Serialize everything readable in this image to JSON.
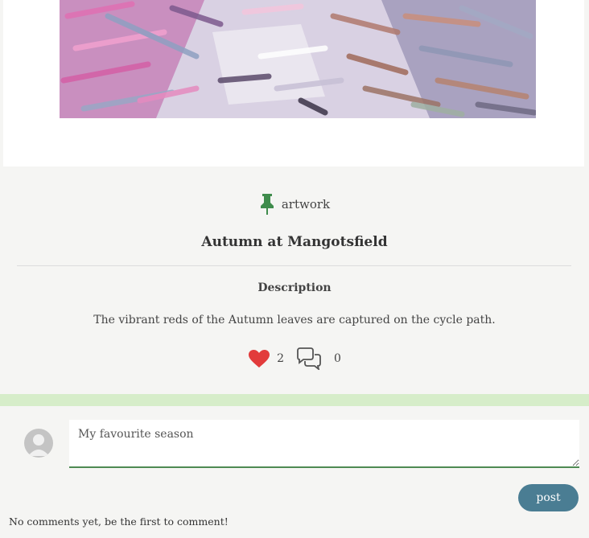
{
  "post": {
    "category": "artwork",
    "title": "Autumn at Mangotsfield",
    "description_heading": "Description",
    "description": "The vibrant reds of the Autumn leaves are captured on the cycle path.",
    "likes": "2",
    "comments": "0"
  },
  "comment_form": {
    "value": "My favourite season",
    "post_label": "post"
  },
  "comments": {
    "empty_message": "No comments yet, be the first to comment!"
  },
  "colors": {
    "background": "#d6edc9",
    "card": "#f5f5f3",
    "pin": "#3f8c4c",
    "heart": "#e23b3b",
    "post_button": "#4a7d93"
  }
}
